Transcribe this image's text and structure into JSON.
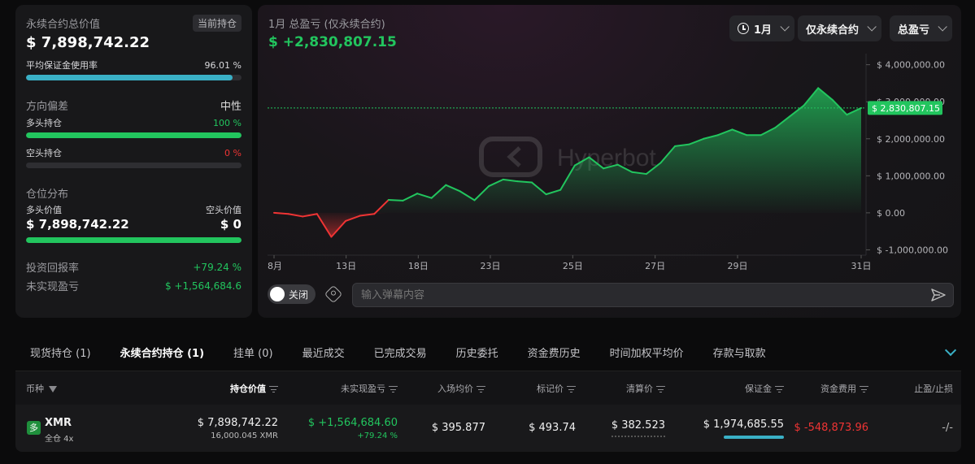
{
  "summary": {
    "total_value_label": "永续合约总价值",
    "current_badge": "当前持仓",
    "total_value": "$ 7,898,742.22",
    "margin_label": "平均保证金使用率",
    "margin_value": "96.01 %",
    "margin_fraction": 0.9601,
    "direction_label": "方向偏差",
    "direction_value": "中性",
    "long_label": "多头持仓",
    "long_value": "100 %",
    "long_fraction": 1.0,
    "short_label": "空头持仓",
    "short_value": "0 %",
    "short_fraction": 0.0,
    "distribution_label": "仓位分布",
    "long_amount_label": "多头价值",
    "short_amount_label": "空头价值",
    "long_amount": "$ 7,898,742.22",
    "short_amount": "$ 0",
    "distribution_long_fraction": 1.0,
    "roi_label": "投资回报率",
    "roi_value": "+79.24 %",
    "unrealized_label": "未实现盈亏",
    "unrealized_value": "$ +1,564,684.6"
  },
  "chart_header": {
    "title": "1月 总盈亏 (仅永续合约)",
    "value": "$ +2,830,807.15",
    "watermark": "Hyperbot"
  },
  "controls": {
    "period": "1月",
    "scope": "仅永续合约",
    "metric": "总盈亏",
    "toggle_label": "关闭",
    "danmaku_placeholder": "输入弹幕内容"
  },
  "chart_data": {
    "type": "area",
    "title": "1月 总盈亏 (仅永续合约)",
    "ylim": [
      -1100000,
      4300000
    ],
    "y_ticks": [
      4000000,
      3000000,
      2000000,
      1000000,
      0,
      -1000000
    ],
    "y_tick_labels": [
      "$ 4,000,000.00",
      "$ 3,000,000.00",
      "$ 2,000,000.00",
      "$ 1,000,000.00",
      "$ 0.00",
      "$ -1,000,000.00"
    ],
    "x_tick_labels": [
      "8月",
      "13日",
      "18日",
      "23日",
      "25日",
      "27日",
      "29日",
      "31日"
    ],
    "x_tick_index": [
      0,
      7,
      14,
      21,
      29,
      37,
      45,
      57
    ],
    "current_value": 2830807.15,
    "current_label": "$ 2,830,807.15",
    "values": [
      0,
      -30000,
      -100000,
      -30000,
      -650000,
      -220000,
      -80000,
      -30000,
      350000,
      330000,
      520000,
      400000,
      750000,
      580000,
      340000,
      720000,
      900000,
      850000,
      820000,
      500000,
      620000,
      1280000,
      1500000,
      1200000,
      1300000,
      1100000,
      1050000,
      1350000,
      1800000,
      1850000,
      2000000,
      2100000,
      2250000,
      2100000,
      2100000,
      2300000,
      2600000,
      2900000,
      3370000,
      3050000,
      2650000,
      2830807
    ]
  },
  "tabs": [
    "现货持仓 (1)",
    "永续合约持仓 (1)",
    "挂单 (0)",
    "最近成交",
    "已完成交易",
    "历史委托",
    "资金费历史",
    "时间加权平均价",
    "存款与取款"
  ],
  "table": {
    "headers": [
      "币种",
      "持仓价值",
      "未实现盈亏",
      "入场均价",
      "标记价",
      "清算价",
      "保证金",
      "资金费用",
      "止盈/止损"
    ],
    "row": {
      "side_badge": "多",
      "coin": "XMR",
      "leverage": "全仓 4x",
      "value": "$ 7,898,742.22",
      "qty": "16,000.045 XMR",
      "pnl": "$ +1,564,684.60",
      "pnl_pct": "+79.24 %",
      "entry": "$ 395.877",
      "mark": "$ 493.74",
      "liq": "$ 382.523",
      "margin": "$ 1,974,685.55",
      "funding": "$ -548,873.96",
      "tpsl": "-/-"
    }
  },
  "colors": {
    "green": "#22c55e",
    "red": "#ef3434",
    "accent": "#3ab0c6"
  }
}
